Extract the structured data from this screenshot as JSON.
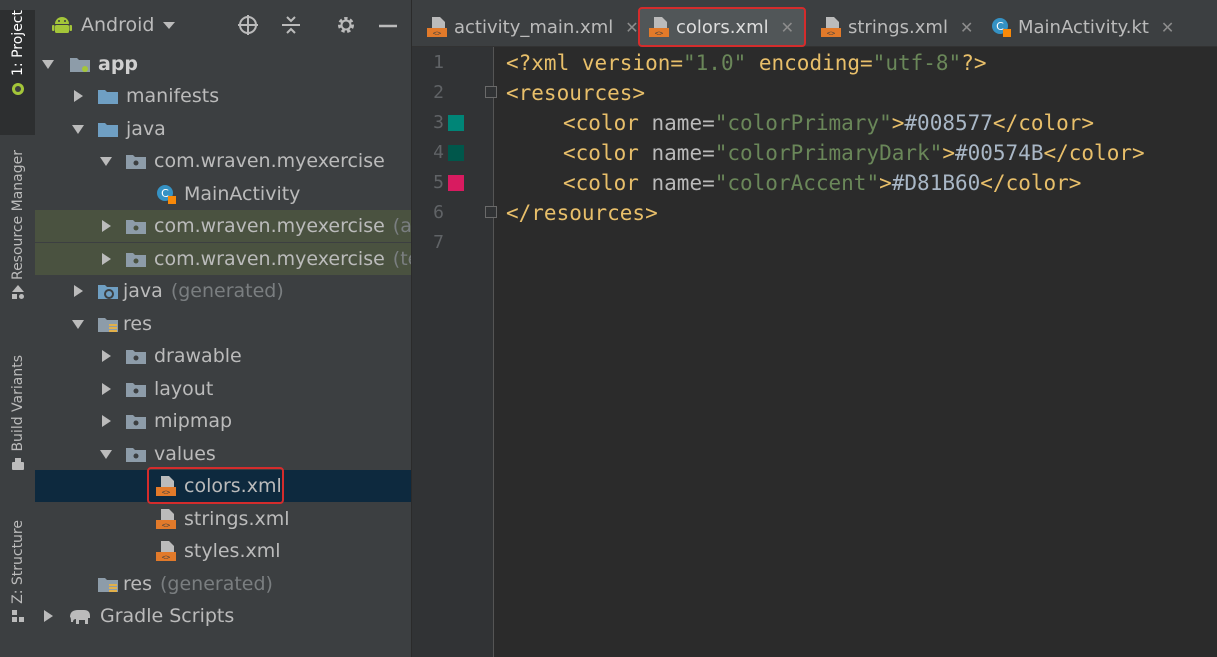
{
  "tool_strip": {
    "tabs": [
      {
        "label": "1: Project"
      },
      {
        "label": "Resource Manager"
      },
      {
        "label": "Build Variants"
      },
      {
        "label": "Z: Structure"
      }
    ]
  },
  "project_panel": {
    "view": "Android",
    "tree": [
      {
        "label": "app",
        "suffix": ""
      },
      {
        "label": "manifests",
        "suffix": ""
      },
      {
        "label": "java",
        "suffix": ""
      },
      {
        "label": "com.wraven.myexercise",
        "suffix": ""
      },
      {
        "label": "MainActivity",
        "suffix": ""
      },
      {
        "label": "com.wraven.myexercise",
        "suffix": "(and"
      },
      {
        "label": "com.wraven.myexercise",
        "suffix": "(test"
      },
      {
        "label": "java",
        "suffix": "(generated)"
      },
      {
        "label": "res",
        "suffix": ""
      },
      {
        "label": "drawable",
        "suffix": ""
      },
      {
        "label": "layout",
        "suffix": ""
      },
      {
        "label": "mipmap",
        "suffix": ""
      },
      {
        "label": "values",
        "suffix": ""
      },
      {
        "label": "colors.xml",
        "suffix": ""
      },
      {
        "label": "strings.xml",
        "suffix": ""
      },
      {
        "label": "styles.xml",
        "suffix": ""
      },
      {
        "label": "res",
        "suffix": "(generated)"
      },
      {
        "label": "Gradle Scripts",
        "suffix": ""
      }
    ]
  },
  "editor": {
    "tabs": [
      {
        "label": "activity_main.xml"
      },
      {
        "label": "colors.xml"
      },
      {
        "label": "strings.xml"
      },
      {
        "label": "MainActivity.kt"
      }
    ],
    "line_numbers": [
      "1",
      "2",
      "3",
      "4",
      "5",
      "6",
      "7"
    ],
    "code": {
      "l1": {
        "a": "<?xml version=",
        "b": "\"1.0\"",
        "c": " encoding=",
        "d": "\"utf-8\"",
        "e": "?>"
      },
      "l2": {
        "a": "<resources>"
      },
      "l3": {
        "a": "<color ",
        "b": "name=",
        "c": "\"colorPrimary\"",
        "d": ">",
        "e": "#008577",
        "f": "</color>"
      },
      "l4": {
        "a": "<color ",
        "b": "name=",
        "c": "\"colorPrimaryDark\"",
        "d": ">",
        "e": "#00574B",
        "f": "</color>"
      },
      "l5": {
        "a": "<color ",
        "b": "name=",
        "c": "\"colorAccent\"",
        "d": ">",
        "e": "#D81B60",
        "f": "</color>"
      },
      "l6": {
        "a": "</resources>"
      }
    },
    "swatch_colors": [
      "#008577",
      "#00574B",
      "#D81B60"
    ]
  },
  "highlight_color": "#d42c2c"
}
